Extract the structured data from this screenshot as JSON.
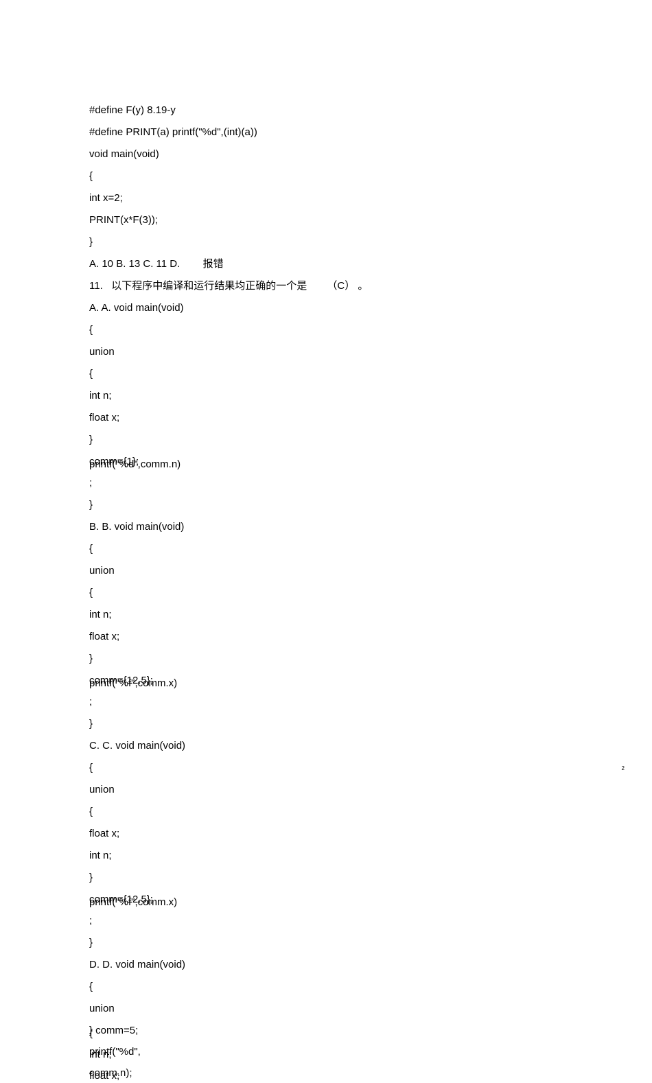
{
  "lines": {
    "l1": "#define F(y) 8.19-y",
    "l2": "#define PRINT(a) printf(\"%d\",(int)(a))",
    "l3": "void main(void)",
    "l4": "{",
    "l5": "int x=2;",
    "l6": "PRINT(x*F(3));",
    "l7": "}",
    "l8": "A. 10 B. 13 C. 11 D.        报错",
    "l9": "11.   以下程序中编译和运行结果均正确的一个是       （C） 。",
    "l10": "A. A. void main(void)",
    "l11": "{",
    "l12": "union",
    "l13": "{",
    "l14": "int n;",
    "l15": "float x;",
    "l16": "}",
    "l18layers": [
      "comm={1};",
      "printf(\"%d\",comm.n)"
    ],
    "l18": ";",
    "l19": "}",
    "l20": "B. B. void main(void)",
    "l21": "{",
    "l22": "union",
    "l23": "{",
    "l24": "int n;",
    "l25": "float x;",
    "l26": "}",
    "l28layers": [
      "comm={12.5};",
      "printf(\"%f\",comm.x)"
    ],
    "l28": ";",
    "l29": "}",
    "l30": "C. C. void main(void)",
    "l31": "{",
    "l32": "union",
    "l33": "{",
    "l34": "float x;",
    "l35": "int n;",
    "l36": "}",
    "l38layers": [
      "comm={12.5};",
      "printf(\"%f\",comm.x)"
    ],
    "l38": ";",
    "l39": "}",
    "l40": "D. D. void main(void)",
    "l41": "{",
    "l42": "union",
    "l43layers": [
      "} comm=5;",
      "{"
    ],
    "l44layers": [
      "printf(\"%d\",",
      "int n;"
    ],
    "l45layers": [
      "comm.n);",
      "float x;"
    ]
  },
  "page_number": "2"
}
